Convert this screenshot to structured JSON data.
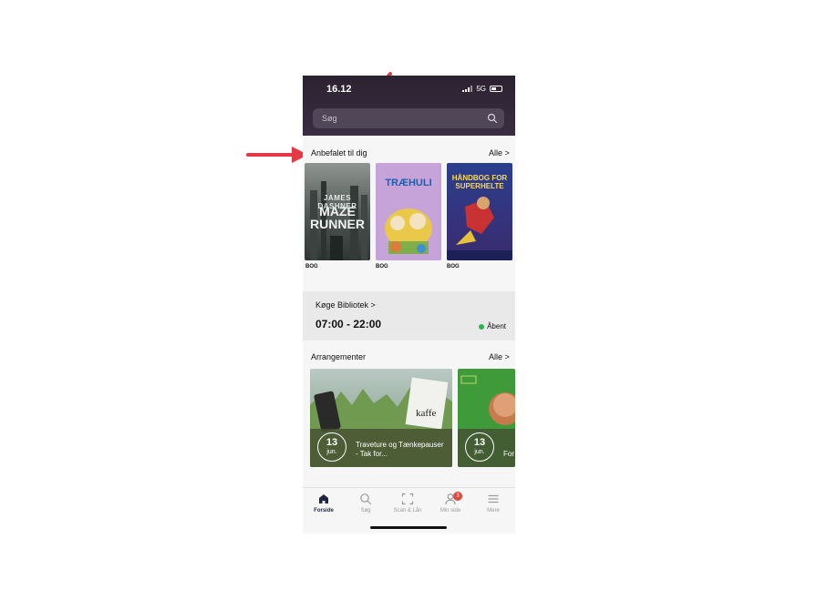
{
  "status": {
    "time": "16.12",
    "network": "5G"
  },
  "search": {
    "placeholder": "Søg"
  },
  "recommended": {
    "title": "Anbefalet til dig",
    "all_label": "Alle >",
    "books": [
      {
        "type": "BOG",
        "cover_title": "MAZE RUNNER",
        "cover_author": "JAMES DASHNER"
      },
      {
        "type": "BOG",
        "cover_title": "TRÆHULI"
      },
      {
        "type": "BOG",
        "cover_title": "HÅNDBOG FOR SUPERHELTE"
      }
    ]
  },
  "library": {
    "name": "Køge Bibliotek  >",
    "hours": "07:00 - 22:00",
    "status": "Åbent"
  },
  "events": {
    "title": "Arrangementer",
    "all_label": "Alle >",
    "items": [
      {
        "day": "13",
        "month": "jun.",
        "title": "Traveture og Tænkepauser - Tak for..."
      },
      {
        "day": "13",
        "month": "jun.",
        "title": "For"
      }
    ]
  },
  "tabs": [
    {
      "label": "Forside",
      "icon": "home-icon"
    },
    {
      "label": "Søg",
      "icon": "search-icon"
    },
    {
      "label": "Scan & Lån",
      "icon": "scan-icon"
    },
    {
      "label": "Min side",
      "icon": "user-icon",
      "badge": "3"
    },
    {
      "label": "Mere",
      "icon": "menu-icon"
    }
  ],
  "colors": {
    "accent_red": "#e63946",
    "header": "#2b2230",
    "open_green": "#2ab44f"
  }
}
